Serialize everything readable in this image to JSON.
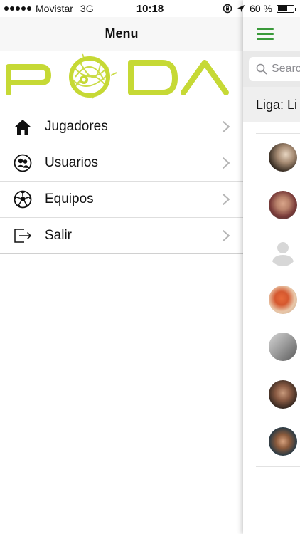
{
  "status_bar": {
    "carrier": "Movistar",
    "network": "3G",
    "time": "10:18",
    "battery": "60 %",
    "battery_level": 0.6
  },
  "drawer": {
    "title": "Menu",
    "logo_text": "PODA",
    "items": [
      {
        "label": "Jugadores",
        "icon": "home-icon"
      },
      {
        "label": "Usuarios",
        "icon": "users-icon"
      },
      {
        "label": "Equipos",
        "icon": "soccer-ball-icon"
      },
      {
        "label": "Salir",
        "icon": "logout-icon"
      }
    ]
  },
  "main": {
    "search_placeholder": "Searc",
    "liga_label": "Liga: Li",
    "players": [
      {
        "avatar": "player-photo"
      },
      {
        "avatar": "player-photo"
      },
      {
        "avatar": "default-avatar"
      },
      {
        "avatar": "player-photo"
      },
      {
        "avatar": "player-photo"
      },
      {
        "avatar": "player-photo"
      },
      {
        "avatar": "player-photo"
      }
    ]
  },
  "colors": {
    "accent_green": "#3a9a3a",
    "logo_lime": "#c6d935",
    "header_bg": "#f7f7f7"
  }
}
